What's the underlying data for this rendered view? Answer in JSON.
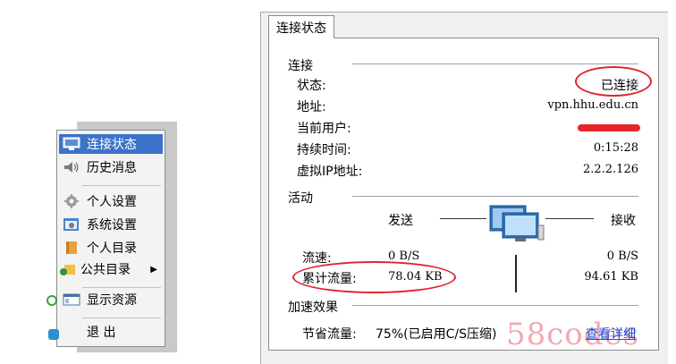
{
  "menu": {
    "items": [
      {
        "label": "连接状态",
        "icon": "monitor-icon"
      },
      {
        "label": "历史消息",
        "icon": "speaker-icon"
      },
      {
        "label": "个人设置",
        "icon": "gear-icon"
      },
      {
        "label": "系统设置",
        "icon": "settings-window-icon"
      },
      {
        "label": "个人目录",
        "icon": "book-folder-icon"
      },
      {
        "label": "公共目录",
        "icon": "shared-folder-icon"
      },
      {
        "label": "显示资源",
        "icon": "window-icon"
      },
      {
        "label": "退 出",
        "icon": ""
      }
    ]
  },
  "panel": {
    "tab_label": "连接状态",
    "connection": {
      "group_title": "连接",
      "status_label": "状态:",
      "status_value": "已连接",
      "address_label": "地址:",
      "address_value": "vpn.hhu.edu.cn",
      "user_label": "当前用户:",
      "duration_label": "持续时间:",
      "duration_value": "0:15:28",
      "vip_label": "虚拟IP地址:",
      "vip_value": "2.2.2.126"
    },
    "activity": {
      "group_title": "活动",
      "send_label": "发送",
      "recv_label": "接收",
      "speed_label": "流速:",
      "speed_send": "0 B/S",
      "speed_recv": "0 B/S",
      "total_label": "累计流量:",
      "total_send": "78.04 KB",
      "total_recv": "94.61 KB"
    },
    "accel": {
      "group_title": "加速效果",
      "saved_label": "节省流量:",
      "saved_value": "75%(已启用C/S压缩)",
      "details_link": "查看详细"
    }
  },
  "watermark": "58codes",
  "colors": {
    "highlight": "#3a73c7",
    "annotation": "#e0232b",
    "link": "#1a4fd6"
  }
}
